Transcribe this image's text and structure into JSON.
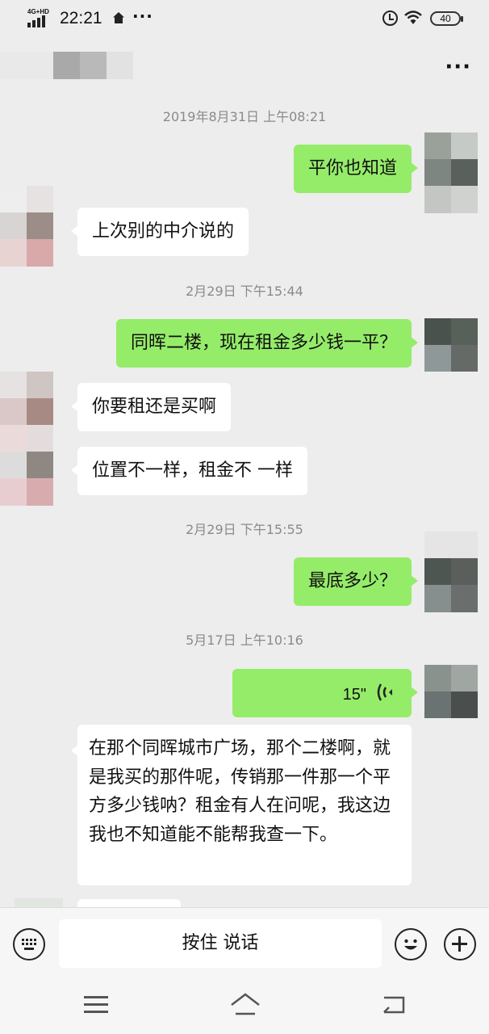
{
  "status_bar": {
    "network": "4G+HD",
    "time": "22:21",
    "more": "···",
    "battery": "40"
  },
  "header": {
    "more_label": "···"
  },
  "messages": {
    "ts1": "2019年8月31日 上午08:21",
    "m1": "平你也知道",
    "m2": "上次别的中介说的",
    "ts2": "2月29日 下午15:44",
    "m3": "同晖二楼，现在租金多少钱一平？",
    "m4": "你要租还是买啊",
    "m5": "位置不一样，租金不 一样",
    "ts3": "2月29日 下午15:55",
    "m6": "最底多少？",
    "ts4": "5月17日 上午10:16",
    "voice_duration": "15\"",
    "m7": "在那个同晖城市广场，那个二楼啊，就是我买的那件呢，传销那一件那一个平方多少钱呐？租金有人在问呢，我这边我也不知道能不能帮我查一下。"
  },
  "input_bar": {
    "talk_label": "按住 说话"
  },
  "colors": {
    "green_bubble": "#95ec69",
    "white_bubble": "#ffffff",
    "background": "#ededed"
  }
}
